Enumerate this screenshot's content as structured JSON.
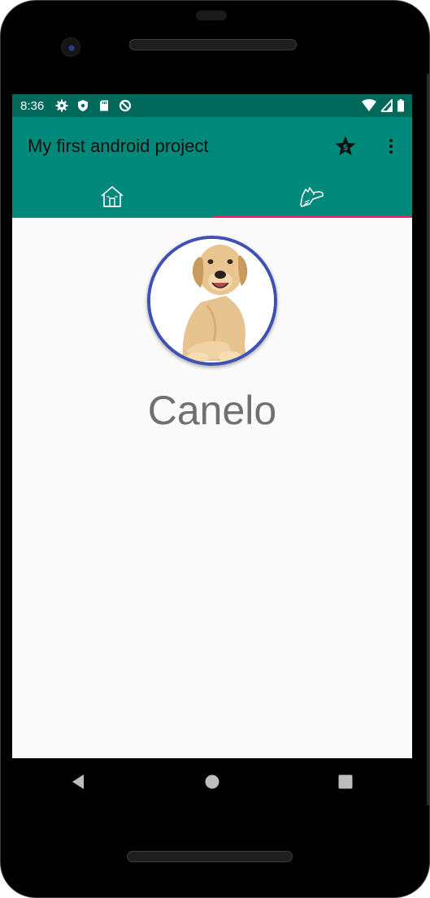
{
  "status_bar": {
    "time": "8:36",
    "icons_left": [
      "settings-icon",
      "shield-icon",
      "sd-card-icon",
      "sync-off-icon"
    ],
    "icons_right": [
      "wifi-icon",
      "cell-signal-icon",
      "battery-icon"
    ]
  },
  "toolbar": {
    "title": "My first android project",
    "actions": [
      {
        "icon": "star-dollar-icon",
        "label": "$"
      },
      {
        "icon": "more-vert-icon"
      }
    ]
  },
  "tabs": [
    {
      "icon": "home-icon",
      "selected": false
    },
    {
      "icon": "dog-icon",
      "selected": true
    }
  ],
  "profile": {
    "avatar": "dog-photo",
    "name": "Canelo"
  },
  "nav_bar": [
    "back-icon",
    "home-circle-icon",
    "recents-icon"
  ],
  "colors": {
    "status_bar": "#00695c",
    "primary": "#00897b",
    "accent": "#e91e63",
    "avatar_border": "#3f51b5",
    "name_text": "#707070",
    "background": "#fafafa"
  }
}
